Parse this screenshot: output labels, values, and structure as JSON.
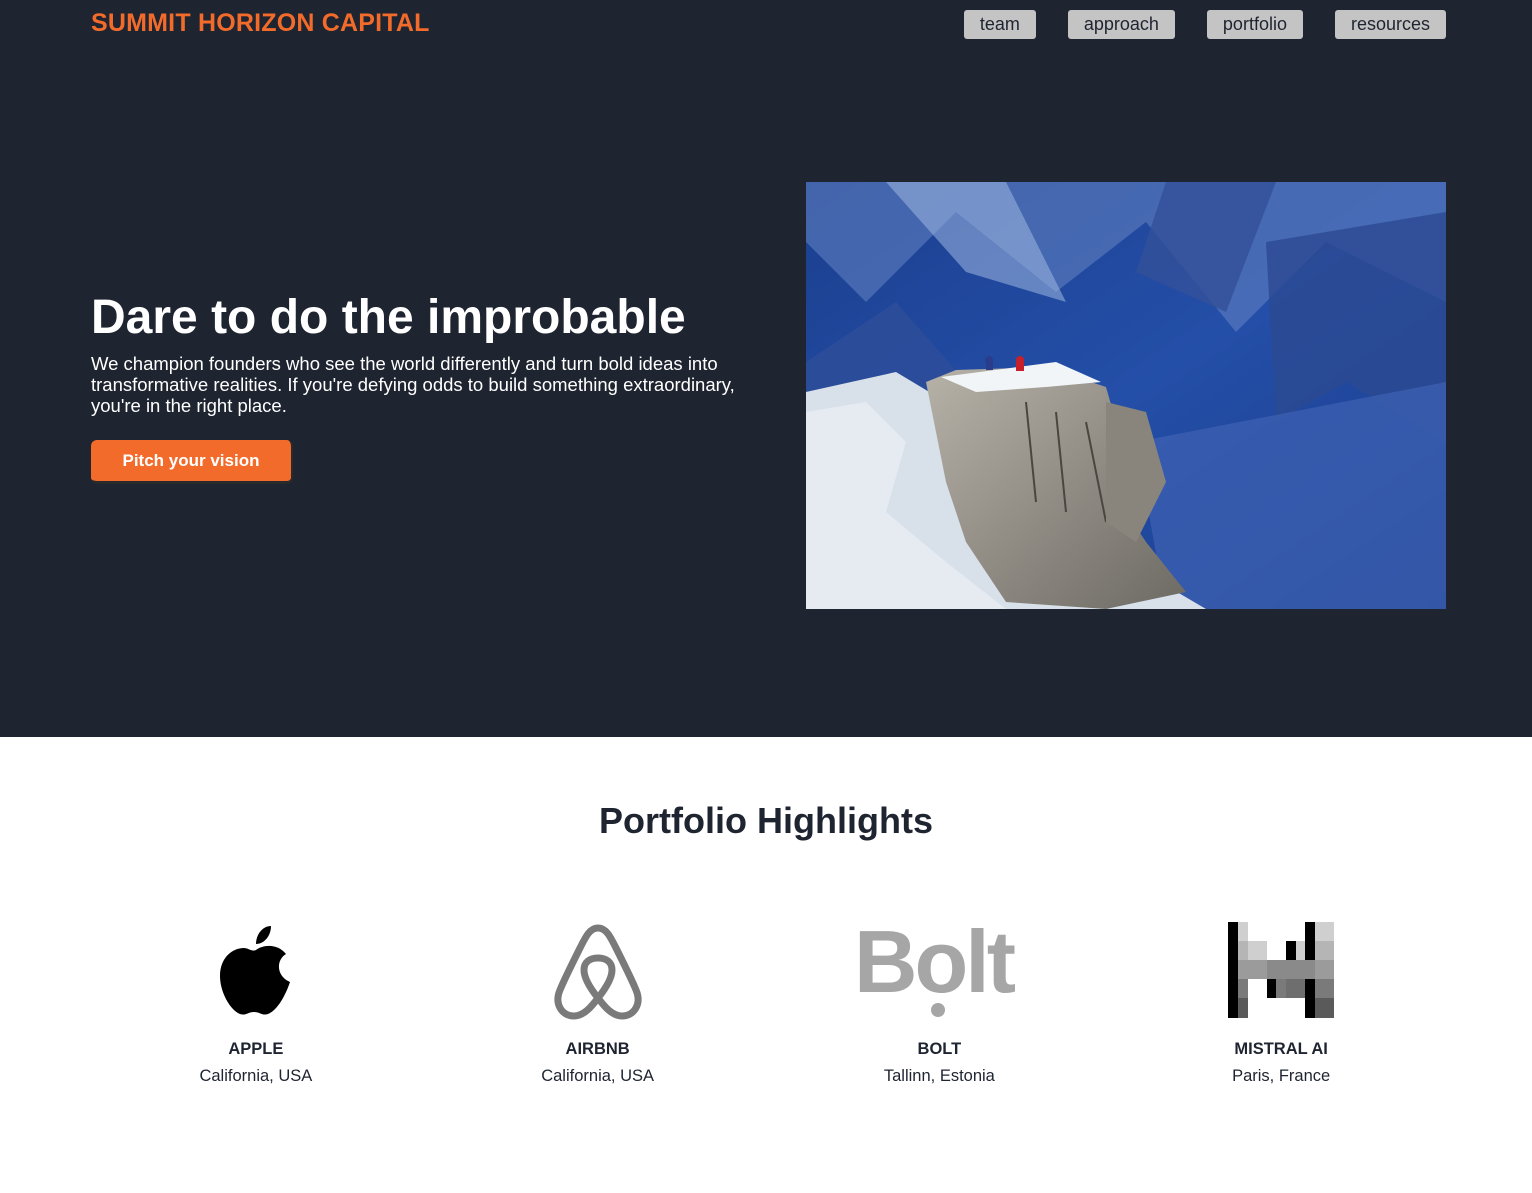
{
  "brand": "SUMMIT HORIZON CAPITAL",
  "nav": {
    "items": [
      "team",
      "approach",
      "portfolio",
      "resources"
    ]
  },
  "hero": {
    "headline": "Dare to do the improbable",
    "lede": "We champion founders who see the world differently and turn bold ideas into transformative realities. If you're defying odds to build something extraordinary, you're in the right place.",
    "cta": "Pitch your vision",
    "image": "mountain-climbers-photo"
  },
  "portfolio": {
    "title": "Portfolio Highlights",
    "companies": [
      {
        "name": "APPLE",
        "location": "California, USA",
        "logo": "apple-logo"
      },
      {
        "name": "AIRBNB",
        "location": "California, USA",
        "logo": "airbnb-logo"
      },
      {
        "name": "BOLT",
        "location": "Tallinn, Estonia",
        "logo": "bolt-logo",
        "logo_text": "Bolt"
      },
      {
        "name": "MISTRAL AI",
        "location": "Paris, France",
        "logo": "mistral-logo"
      }
    ]
  },
  "colors": {
    "accent": "#f26b2a",
    "dark": "#1e2430",
    "nav_button": "#c4c4c4"
  }
}
